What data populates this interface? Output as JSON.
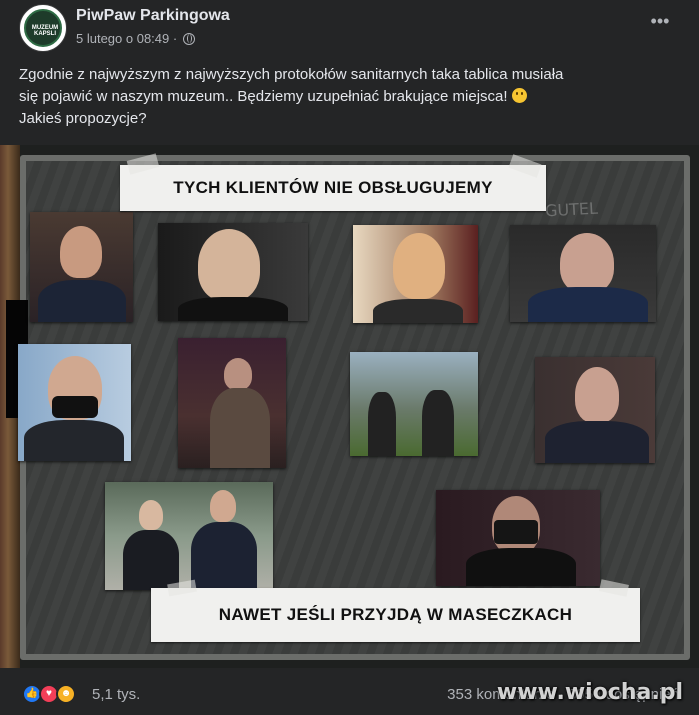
{
  "post": {
    "page_name": "PiwPaw Parkingowa",
    "timestamp": "5 lutego o 08:49",
    "visibility_separator": " · ",
    "avatar_text": "MUZEUM KAPSLI",
    "more_label": "•••",
    "text_line1": "Zgodnie z najwyższym z najwyższych protokołów sanitarnych taka tablica musiała",
    "text_line2": "się pojawić w naszym muzeum.. Będziemy uzupełniać brakujące miejsca!",
    "text_line3": "Jakieś propozycje?"
  },
  "photo": {
    "banner_top": "TYCH KLIENTÓW NIE OBSŁUGUJEMY",
    "banner_bottom": "NAWET JEŚLI PRZYJDĄ W MASECZKACH",
    "board_scribble": "GUTEL"
  },
  "footer": {
    "reaction_icons": [
      "like-icon",
      "love-icon",
      "haha-icon"
    ],
    "reaction_count": "5,1 tys.",
    "comments": "353 komentarze · 395 udostępnień"
  },
  "watermark": "www.wiocha.pl",
  "colors": {
    "background": "#242526",
    "text_primary": "#e4e6eb",
    "text_secondary": "#b0b3b8",
    "like_blue": "#2078f4",
    "love_red": "#f33e58",
    "haha_yellow": "#f7b125"
  }
}
